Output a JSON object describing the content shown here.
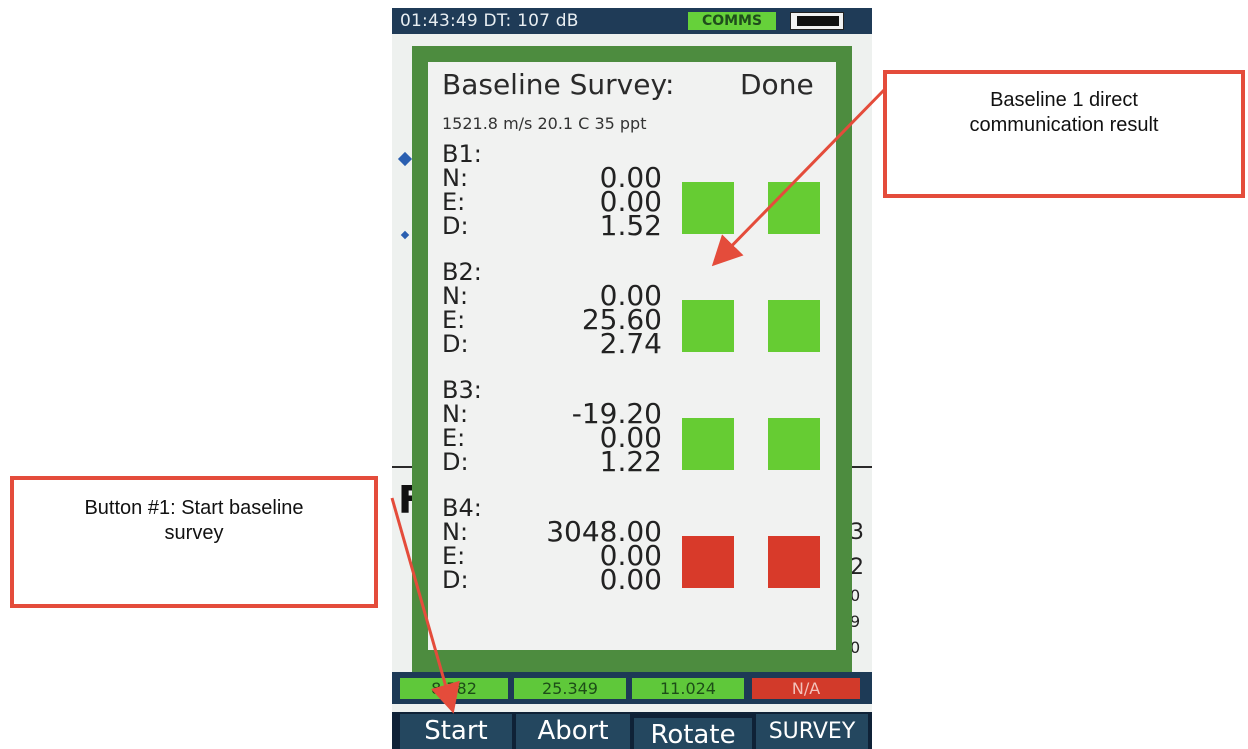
{
  "status_bar": {
    "text": "01:43:49 DT: 107 dB",
    "comms_label": "COMMS"
  },
  "dialog": {
    "title": "Baseline Survey:",
    "status": "Done",
    "subtitle": "1521.8 m/s  20.1 C  35 ppt",
    "baselines": [
      {
        "name": "B1:",
        "rows": [
          {
            "label": "N:",
            "value": "0.00"
          },
          {
            "label": "E:",
            "value": "0.00"
          },
          {
            "label": "D:",
            "value": "1.52"
          }
        ],
        "indicator_1": "#66cc33",
        "indicator_2": "#66cc33"
      },
      {
        "name": "B2:",
        "rows": [
          {
            "label": "N:",
            "value": "0.00"
          },
          {
            "label": "E:",
            "value": "25.60"
          },
          {
            "label": "D:",
            "value": "2.74"
          }
        ],
        "indicator_1": "#66cc33",
        "indicator_2": "#66cc33"
      },
      {
        "name": "B3:",
        "rows": [
          {
            "label": "N:",
            "value": "-19.20"
          },
          {
            "label": "E:",
            "value": "0.00"
          },
          {
            "label": "D:",
            "value": "1.22"
          }
        ],
        "indicator_1": "#66cc33",
        "indicator_2": "#66cc33"
      },
      {
        "name": "B4:",
        "rows": [
          {
            "label": "N:",
            "value": "3048.00"
          },
          {
            "label": "E:",
            "value": "0.00"
          },
          {
            "label": "D:",
            "value": "0.00"
          }
        ],
        "indicator_1": "#d83a2a",
        "indicator_2": "#d83a2a"
      }
    ]
  },
  "background": {
    "right_digits": [
      "3",
      "2",
      "0",
      "9",
      "0"
    ]
  },
  "value_bar": [
    {
      "text": "8.782",
      "color": "#5fc83a"
    },
    {
      "text": "25.349",
      "color": "#5fc83a"
    },
    {
      "text": "11.024",
      "color": "#5fc83a"
    },
    {
      "text": "N/A",
      "color": "#d23a2a"
    }
  ],
  "buttons": [
    "Start",
    "Abort",
    "Rotate",
    "SURVEY"
  ],
  "annotations": {
    "baseline_callout": "Baseline 1 direct communication result",
    "button_callout": "Button #1: Start baseline survey"
  }
}
